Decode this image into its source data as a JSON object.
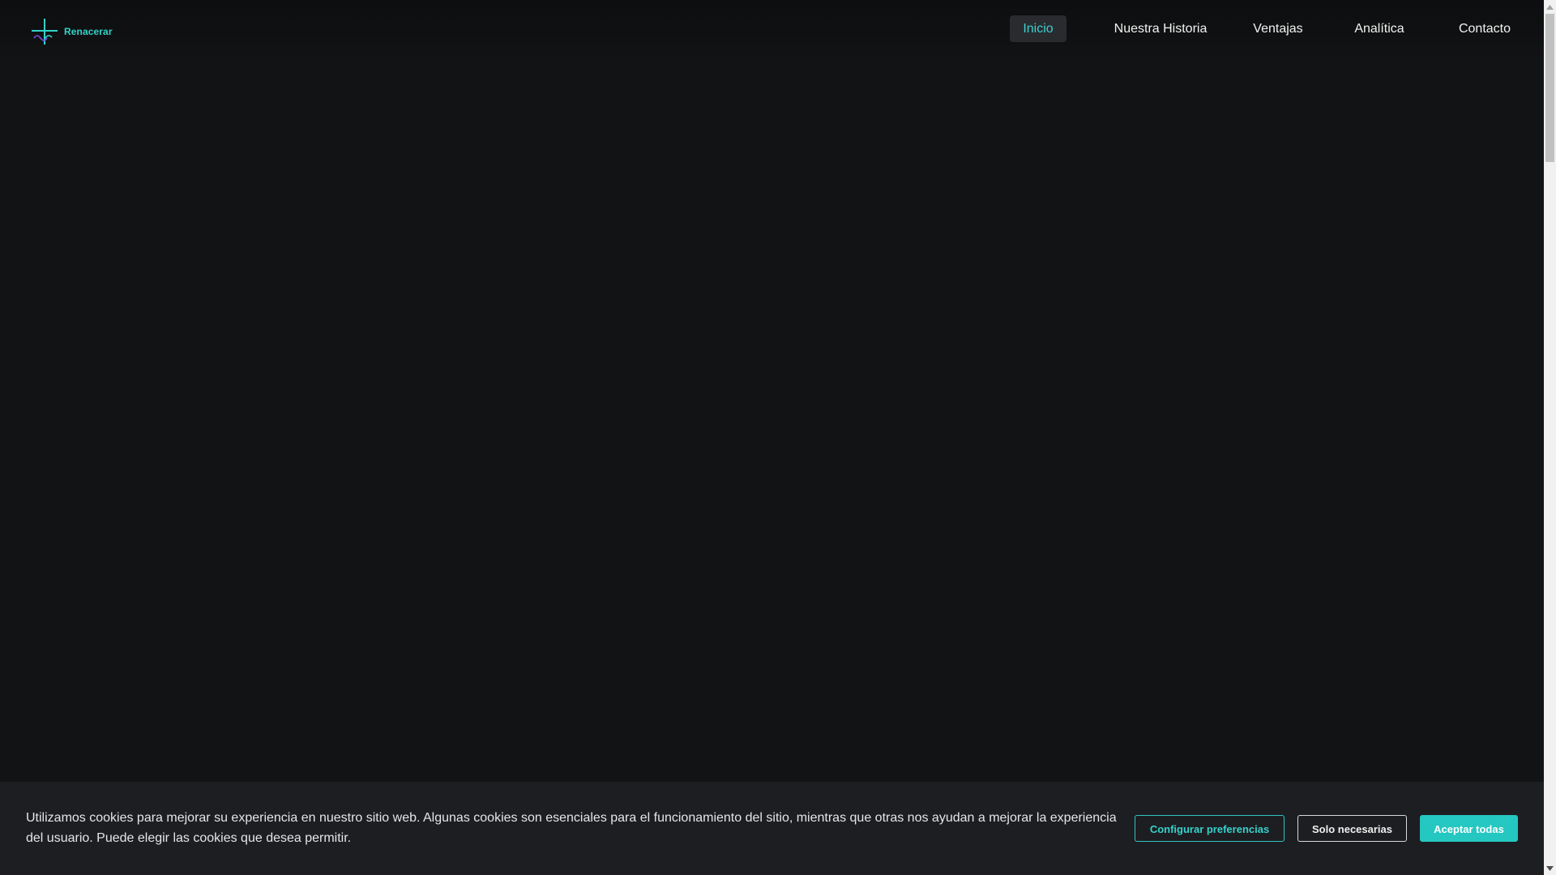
{
  "brand": {
    "name": "Renacerar",
    "accent_color": "#33d3c9",
    "secondary_color": "#7a4de0",
    "logo_icon": "cross-wave-logo-icon"
  },
  "nav": {
    "items": [
      {
        "label": "Inicio",
        "active": true
      },
      {
        "label": "Nuestra Historia",
        "active": false
      },
      {
        "label": "Ventajas",
        "active": false
      },
      {
        "label": "Analítica",
        "active": false
      },
      {
        "label": "Contacto",
        "active": false
      }
    ]
  },
  "cookie_banner": {
    "message": "Utilizamos cookies para mejorar su experiencia en nuestro sitio web. Algunas cookies son esenciales para el funcionamiento del sitio, mientras que otras nos ayudan a mejorar la experiencia del usuario. Puede elegir las cookies que desea permitir.",
    "configure_label": "Configurar preferencias",
    "necessary_label": "Solo necesarias",
    "accept_label": "Aceptar todas",
    "accent_color": "#25c7c1"
  },
  "colors": {
    "background": "#121314",
    "banner_background": "#1d1e22",
    "active_nav_background": "#2a2b2f"
  }
}
